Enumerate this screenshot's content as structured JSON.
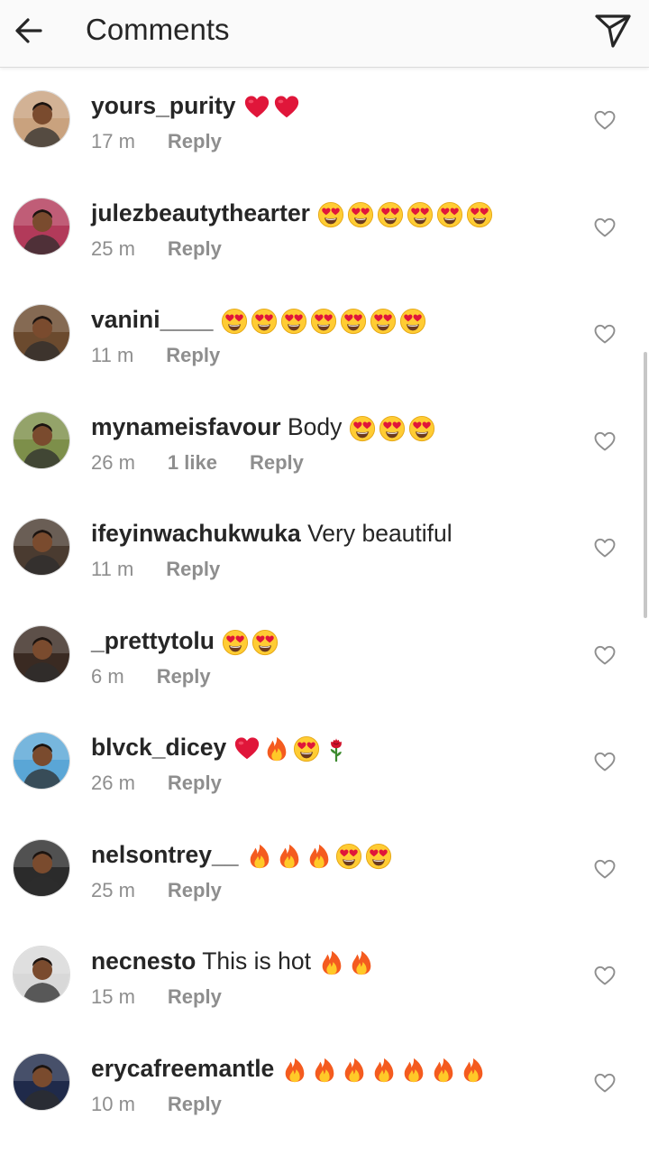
{
  "header": {
    "title": "Comments",
    "back_icon": "arrow-left-icon",
    "share_icon": "paper-plane-icon"
  },
  "comments": [
    {
      "username": "yours_purity",
      "text": "",
      "emojis": [
        "heart",
        "heart"
      ],
      "time": "17 m",
      "likes": "",
      "reply": "Reply",
      "avatar_color": "#c9a27e"
    },
    {
      "username": "julezbeautythearter",
      "text": "",
      "emojis": [
        "heart-eyes",
        "heart-eyes",
        "heart-eyes",
        "heart-eyes",
        "heart-eyes",
        "heart-eyes"
      ],
      "time": "25 m",
      "likes": "",
      "reply": "Reply",
      "avatar_color": "#b23a5a"
    },
    {
      "username": "vanini____",
      "text": "",
      "emojis": [
        "heart-eyes",
        "heart-eyes",
        "heart-eyes",
        "heart-eyes",
        "heart-eyes",
        "heart-eyes",
        "heart-eyes"
      ],
      "time": "11 m",
      "likes": "",
      "reply": "Reply",
      "avatar_color": "#6b4a2e"
    },
    {
      "username": "mynameisfavour",
      "text": "Body",
      "emojis": [
        "heart-eyes",
        "heart-eyes",
        "heart-eyes"
      ],
      "time": "26 m",
      "likes": "1 like",
      "reply": "Reply",
      "avatar_color": "#7d8f4a"
    },
    {
      "username": "ifeyinwachukwuka",
      "text": "Very beautiful",
      "emojis": [],
      "time": "11 m",
      "likes": "",
      "reply": "Reply",
      "avatar_color": "#4a3b30"
    },
    {
      "username": "_prettytolu",
      "text": "",
      "emojis": [
        "heart-eyes",
        "heart-eyes"
      ],
      "time": "6 m",
      "likes": "",
      "reply": "Reply",
      "avatar_color": "#3a2a22"
    },
    {
      "username": "blvck_dicey",
      "text": "",
      "emojis": [
        "heart",
        "fire",
        "heart-eyes",
        "rose"
      ],
      "time": "26 m",
      "likes": "",
      "reply": "Reply",
      "avatar_color": "#5aa6d6"
    },
    {
      "username": "nelsontrey__",
      "text": "",
      "emojis": [
        "fire",
        "fire",
        "fire",
        "heart-eyes",
        "heart-eyes"
      ],
      "time": "25 m",
      "likes": "",
      "reply": "Reply",
      "avatar_color": "#2b2b2b"
    },
    {
      "username": "necnesto",
      "text": "This is hot",
      "emojis": [
        "fire",
        "fire"
      ],
      "time": "15 m",
      "likes": "",
      "reply": "Reply",
      "avatar_color": "#d8d8d8"
    },
    {
      "username": "erycafreemantle",
      "text": "",
      "emojis": [
        "fire",
        "fire",
        "fire",
        "fire",
        "fire",
        "fire",
        "fire"
      ],
      "time": "10 m",
      "likes": "",
      "reply": "Reply",
      "avatar_color": "#1f2a4a"
    }
  ],
  "like_icon": "heart-outline-icon"
}
